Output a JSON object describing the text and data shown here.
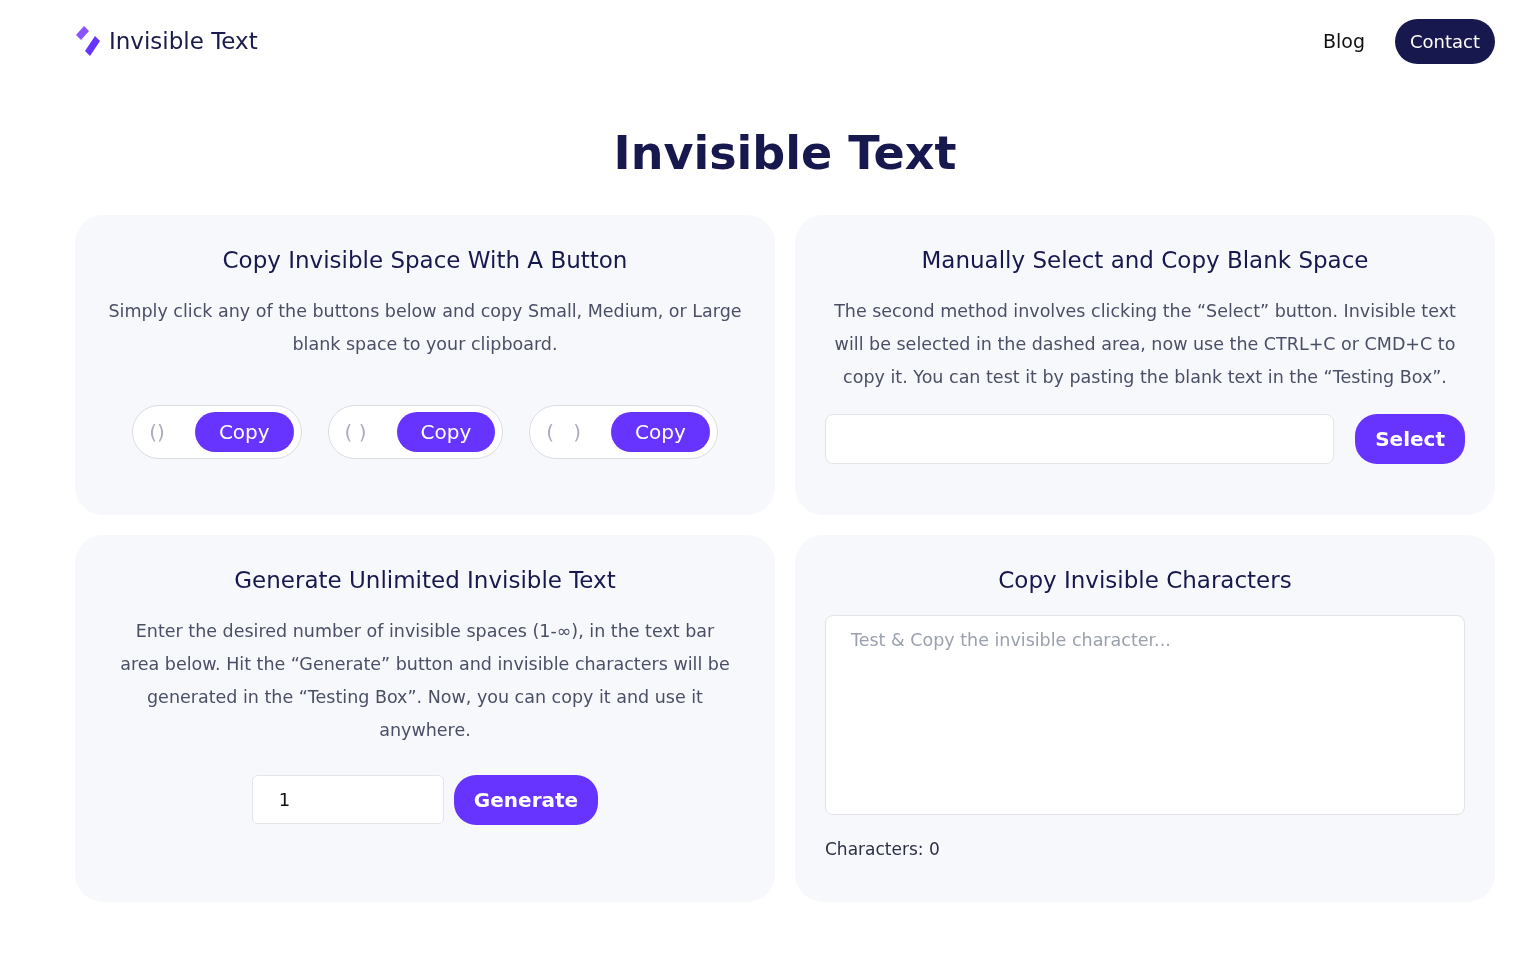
{
  "header": {
    "brand": "Invisible Text",
    "nav": [
      {
        "kind": "link",
        "label": "Blog"
      },
      {
        "kind": "button",
        "label": "Contact"
      }
    ]
  },
  "title": "Invisible Text",
  "copy_card": {
    "title": "Copy Invisible Space With A Button",
    "text": "Simply click any of the buttons below and copy Small, Medium, or Large blank space to your clipboard.",
    "items": [
      {
        "sample": "()",
        "button": "Copy"
      },
      {
        "sample": "( )",
        "button": "Copy"
      },
      {
        "sample": "(   )",
        "button": "Copy"
      }
    ]
  },
  "select_card": {
    "title": "Manually Select and Copy Blank Space",
    "text": "The second method involves clicking the “Select” button. Invisible text will be selected in the dashed area, now use the CTRL+C or CMD+C to copy it. You can test it by pasting the blank text in the “Testing Box”.",
    "button": "Select"
  },
  "generate_card": {
    "title": "Generate Unlimited Invisible Text",
    "text": "Enter the desired number of invisible spaces (1-∞), in the text bar area below. Hit the “Generate” button and invisible characters will be generated in the “Testing Box”. Now, you can copy it and use it anywhere.",
    "value": "1",
    "button": "Generate"
  },
  "test_card": {
    "title": "Copy Invisible Characters",
    "placeholder": "Test & Copy the invisible character...",
    "count": "Characters: 0"
  }
}
